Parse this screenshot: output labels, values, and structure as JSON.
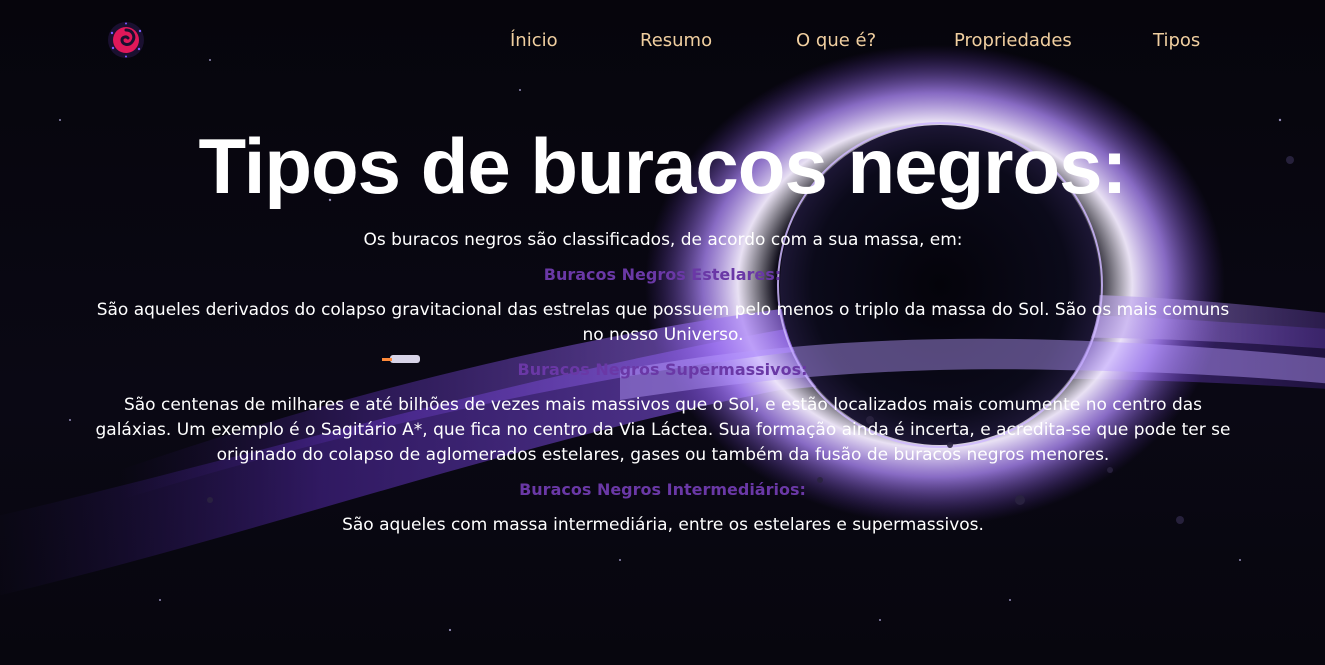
{
  "nav": {
    "logo_icon": "spiral-galaxy-icon",
    "items": [
      {
        "label": "Ínicio"
      },
      {
        "label": "Resumo"
      },
      {
        "label": "O que é?"
      },
      {
        "label": "Propriedades"
      },
      {
        "label": "Tipos"
      }
    ],
    "link_color": "#f0cfa0"
  },
  "main": {
    "title": "Tipos de buracos negros:",
    "intro": "Os buracos negros são classificados, de acordo com a sua massa, em:",
    "sections": [
      {
        "heading": "Buracos Negros Estelares:",
        "text": "São aqueles derivados do colapso gravitacional das estrelas que possuem pelo menos o triplo da massa do Sol. São os mais comuns no nosso Universo."
      },
      {
        "heading": "Buracos Negros Supermassivos:",
        "text": "São centenas de milhares e até bilhões de vezes mais massivos que o Sol, e estão localizados mais comumente no centro das galáxias. Um exemplo é o Sagitário A*, que fica no centro da Via Láctea. Sua formação ainda é incerta, e acredita-se que pode ter se originado do colapso de aglomerados estelares, gases ou também da fusão de buracos negros menores."
      },
      {
        "heading": "Buracos Negros Intermediários:",
        "text": "São aqueles com massa intermediária, entre os estelares e supermassivos."
      }
    ],
    "heading_color": "#6a38a6"
  },
  "background": {
    "description_icon": "black-hole-illustration",
    "accent": "#9b6cff"
  }
}
